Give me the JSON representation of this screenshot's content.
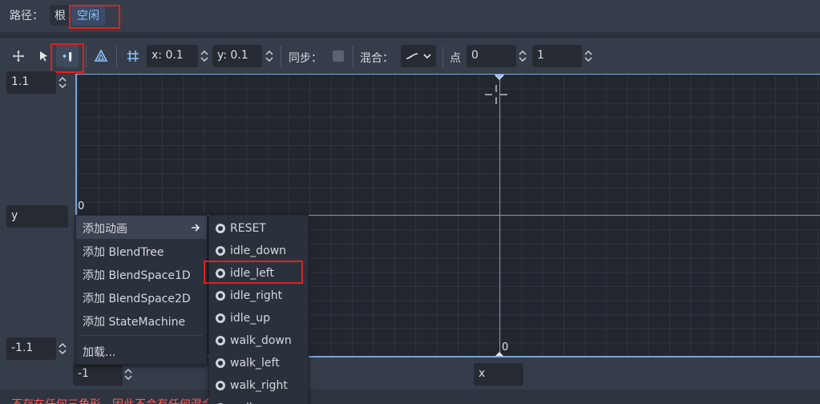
{
  "path": {
    "label": "路径：",
    "items": [
      "根",
      "空闲"
    ]
  },
  "toolbar": {
    "snap_x": "x: 0.1",
    "snap_y": "y: 0.1",
    "sync_label": "同步：",
    "blend_label": "混合：",
    "point_label": "点",
    "point_value": "0",
    "point_extra": "1"
  },
  "left": {
    "max_y": "1.1",
    "y_label": "y",
    "min_y": "-1.1"
  },
  "canvas": {
    "origin_label_left": "0",
    "origin_label_bottom": "0"
  },
  "bottom": {
    "min_x": "-1",
    "x_label": "x",
    "warning": "不存在任何三角形，因此不会有任何混合。"
  },
  "context_menu": {
    "items": [
      "添加动画",
      "添加 BlendTree",
      "添加 BlendSpace1D",
      "添加 BlendSpace2D",
      "添加 StateMachine",
      "加载..."
    ]
  },
  "submenu": {
    "items": [
      "RESET",
      "idle_down",
      "idle_left",
      "idle_right",
      "idle_up",
      "walk_down",
      "walk_left",
      "walk_right",
      "walk_up"
    ]
  },
  "colors": {
    "accent": "#8ec0ff",
    "highlight": "#e0201e",
    "panel": "#363d4a",
    "canvas": "#22262e"
  }
}
